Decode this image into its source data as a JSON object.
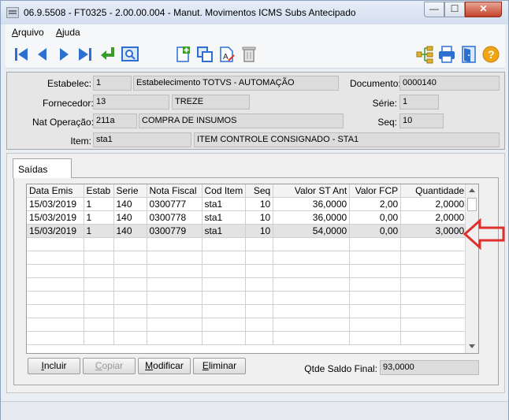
{
  "window": {
    "title": "06.9.5508 - FT0325 - 2.00.00.004 - Manut. Movimentos ICMS Subs Antecipado",
    "minimize": "—",
    "maximize": "☐",
    "close": "✕"
  },
  "menu": {
    "arquivo_first": "A",
    "arquivo_rest": "rquivo",
    "ajuda_first": "A",
    "ajuda_rest": "juda"
  },
  "toolbar": {
    "icons": [
      "first-icon",
      "prev-icon",
      "next-icon",
      "last-icon",
      "goto-icon",
      "zoom-icon",
      "new-document-icon",
      "copy-icon",
      "edit-icon",
      "delete-icon",
      "tree-icon",
      "print-icon",
      "exit-icon",
      "help-icon"
    ]
  },
  "header": {
    "estabelec_label": "Estabelec:",
    "estabelec_code": "1",
    "estabelec_name": "Estabelecimento TOTVS - AUTOMAÇÃO",
    "documento_label": "Documento:",
    "documento": "0000140",
    "fornecedor_label": "Fornecedor:",
    "fornecedor_code": "13",
    "fornecedor_name": "TREZE",
    "serie_label": "Série:",
    "serie": "1",
    "natop_label": "Nat Operação:",
    "natop_code": "211a",
    "natop_name": "COMPRA DE INSUMOS",
    "seq_label": "Seq:",
    "seq": "10",
    "item_label": "Item:",
    "item_code": "sta1",
    "item_name": "ITEM CONTROLE CONSIGNADO - STA1"
  },
  "tab": {
    "label": "Saídas"
  },
  "grid": {
    "columns": [
      "Data Emis",
      "Estab",
      "Serie",
      "Nota Fiscal",
      "Cod Item",
      "Seq",
      "Valor ST Ant",
      "Valor FCP",
      "Quantidade"
    ],
    "rows": [
      [
        "15/03/2019",
        "1",
        "140",
        "0300777",
        "sta1",
        "10",
        "36,0000",
        "2,00",
        "2,0000"
      ],
      [
        "15/03/2019",
        "1",
        "140",
        "0300778",
        "sta1",
        "10",
        "36,0000",
        "0,00",
        "2,0000"
      ],
      [
        "15/03/2019",
        "1",
        "140",
        "0300779",
        "sta1",
        "10",
        "54,0000",
        "0,00",
        "3,0000"
      ]
    ],
    "selected_row": 2
  },
  "buttons": {
    "incluir_first": "I",
    "incluir_rest": "ncluir",
    "copiar_first": "C",
    "copiar_rest": "opiar",
    "modificar_first": "M",
    "modificar_rest": "odificar",
    "eliminar_first": "E",
    "eliminar_rest": "liminar"
  },
  "footer": {
    "saldo_label": "Qtde Saldo Final:",
    "saldo_value": "93,0000"
  },
  "colors": {
    "arrow_red": "#e0302b",
    "toolbar_blue": "#2c6fd1"
  }
}
